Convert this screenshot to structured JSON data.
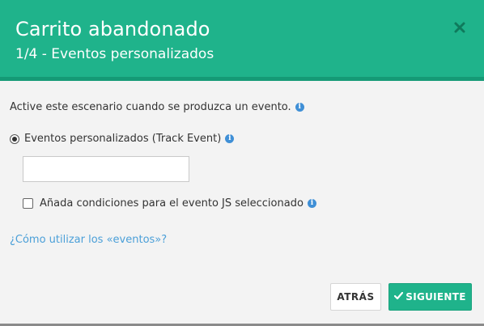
{
  "header": {
    "title": "Carrito abandonado",
    "subtitle": "1/4 - Eventos personalizados",
    "close_icon": "close-icon"
  },
  "body": {
    "intro_text": "Active este escenario cuando se produzca un evento.",
    "radio_label": "Eventos personalizados (Track Event)",
    "radio_selected": true,
    "event_input_value": "",
    "checkbox_label": "Añada condiciones para el evento JS seleccionado",
    "checkbox_checked": false,
    "help_link": "¿Cómo utilizar los «eventos»?"
  },
  "footer": {
    "back_label": "ATRÁS",
    "next_label": "SIGUIENTE"
  },
  "colors": {
    "accent": "#1fb38b",
    "accent_dark": "#159a76",
    "link": "#4a9fd8",
    "info": "#3f8fd6"
  }
}
